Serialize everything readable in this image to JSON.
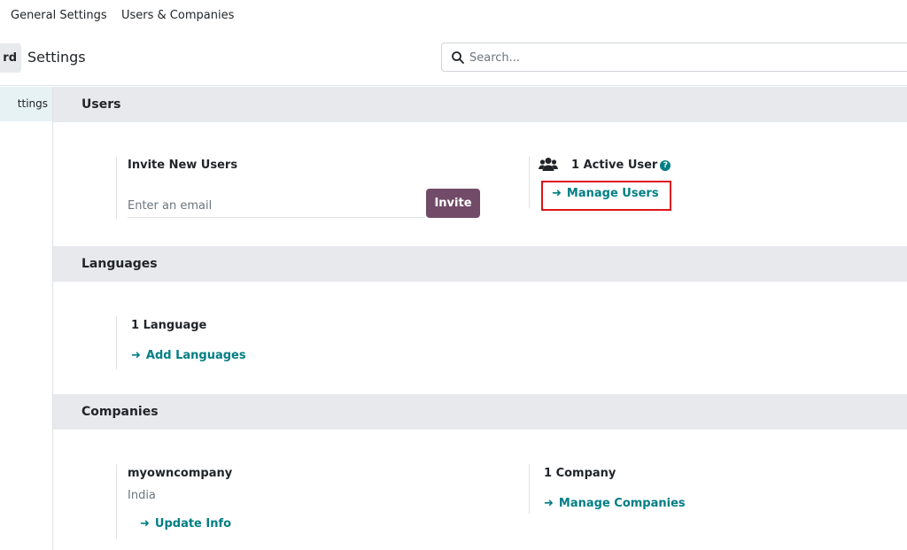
{
  "topnav": {
    "general_settings": "General Settings",
    "users_companies": "Users & Companies"
  },
  "control_bar": {
    "dashboard_label": "rd",
    "title": "Settings",
    "search_placeholder": "Search..."
  },
  "sidebar": {
    "items": [
      {
        "label": "ttings"
      }
    ]
  },
  "sections": {
    "users": {
      "header": "Users",
      "invite_title": "Invite New Users",
      "email_placeholder": "Enter an email",
      "invite_button": "Invite",
      "active_users": "1 Active User",
      "help_icon": "?",
      "manage_users": "Manage Users"
    },
    "languages": {
      "header": "Languages",
      "count": "1 Language",
      "add_languages": "Add Languages"
    },
    "companies": {
      "header": "Companies",
      "company_name": "myowncompany",
      "country": "India",
      "update_info": "Update Info",
      "count": "1 Company",
      "manage_companies": "Manage Companies"
    }
  },
  "colors": {
    "accent_link": "#017e84",
    "brand_button": "#714b67",
    "highlight": "#e0141a"
  },
  "icons": {
    "search": "search-icon",
    "users": "users-icon",
    "help": "help-icon",
    "arrow": "arrow-right-icon"
  }
}
